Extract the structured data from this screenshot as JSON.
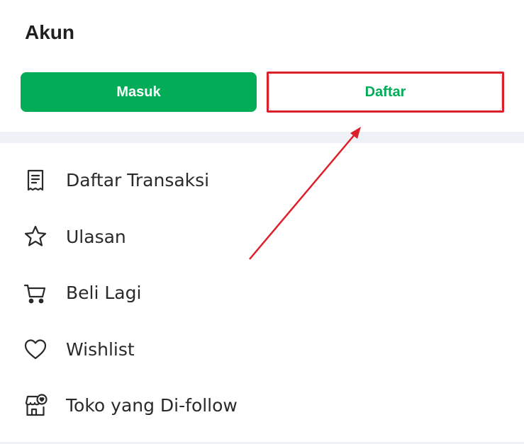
{
  "header": {
    "title": "Akun"
  },
  "auth": {
    "login_label": "Masuk",
    "register_label": "Daftar"
  },
  "menu": {
    "items": [
      {
        "label": "Daftar Transaksi",
        "icon": "receipt-icon"
      },
      {
        "label": "Ulasan",
        "icon": "star-icon"
      },
      {
        "label": "Beli Lagi",
        "icon": "cart-icon"
      },
      {
        "label": "Wishlist",
        "icon": "heart-icon"
      },
      {
        "label": "Toko yang Di-follow",
        "icon": "store-heart-icon"
      }
    ]
  },
  "colors": {
    "accent": "#03ac56",
    "annotation": "#dd1f2a",
    "divider": "#eef2f6"
  }
}
